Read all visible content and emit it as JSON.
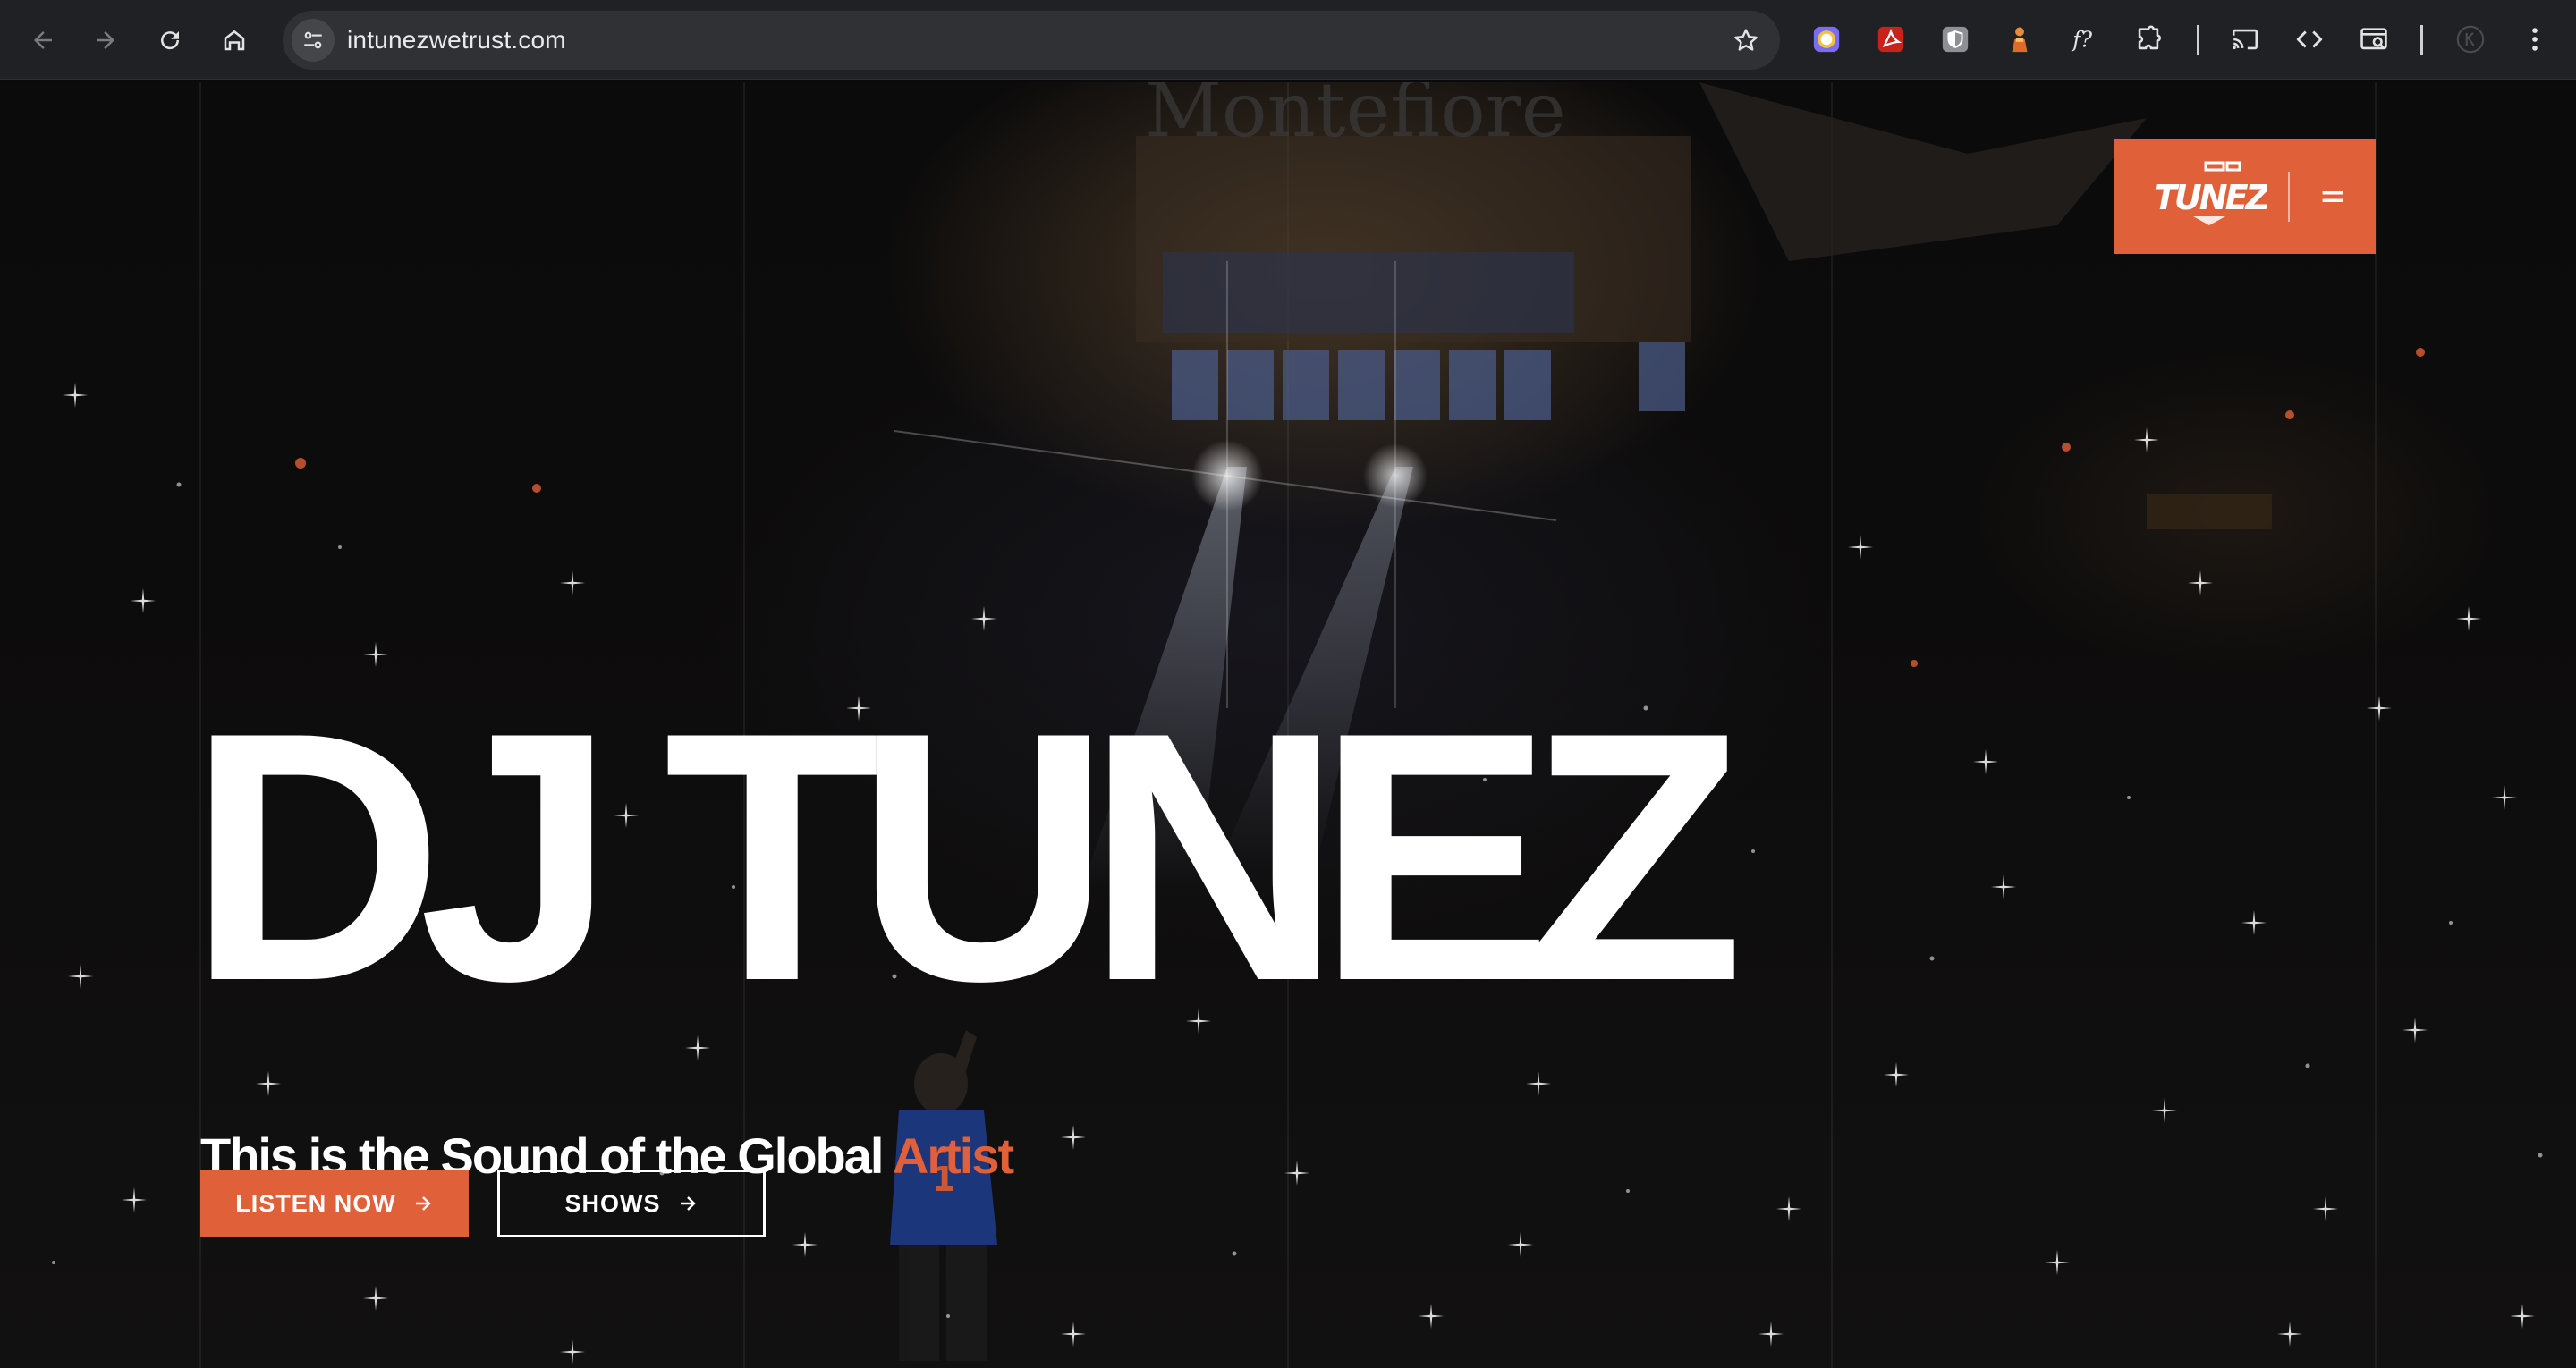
{
  "browser": {
    "url": "intunezwetrust.com"
  },
  "hero": {
    "title": "DJ TUNEZ",
    "subtitle_main": "This is the Sound of the Global ",
    "subtitle_accent": "Artist",
    "buttons": {
      "listen_label": "LISTEN NOW",
      "shows_label": "SHOWS"
    }
  },
  "brand": {
    "logo_text": "TUNEZ"
  },
  "colors": {
    "accent": "#e0603a",
    "chrome_bg": "#202124",
    "omnibox_bg": "#303134",
    "text_light": "#ffffff"
  },
  "icons": {
    "back": "arrow-left-icon",
    "forward": "arrow-right-icon",
    "reload": "reload-icon",
    "home": "home-icon",
    "site_info": "tune-icon",
    "bookmark": "star-icon",
    "extensions": [
      "colorpicker-icon",
      "pdf-icon",
      "shield-icon",
      "figure-icon",
      "font-icon",
      "puzzle-icon"
    ],
    "cast": "cast-icon",
    "devtools": "code-icon",
    "inspect": "inspect-icon",
    "profile": "profile-icon",
    "menu": "more-vert-icon",
    "hamburger": "hamburger-icon",
    "arrow": "arrow-right-icon"
  }
}
